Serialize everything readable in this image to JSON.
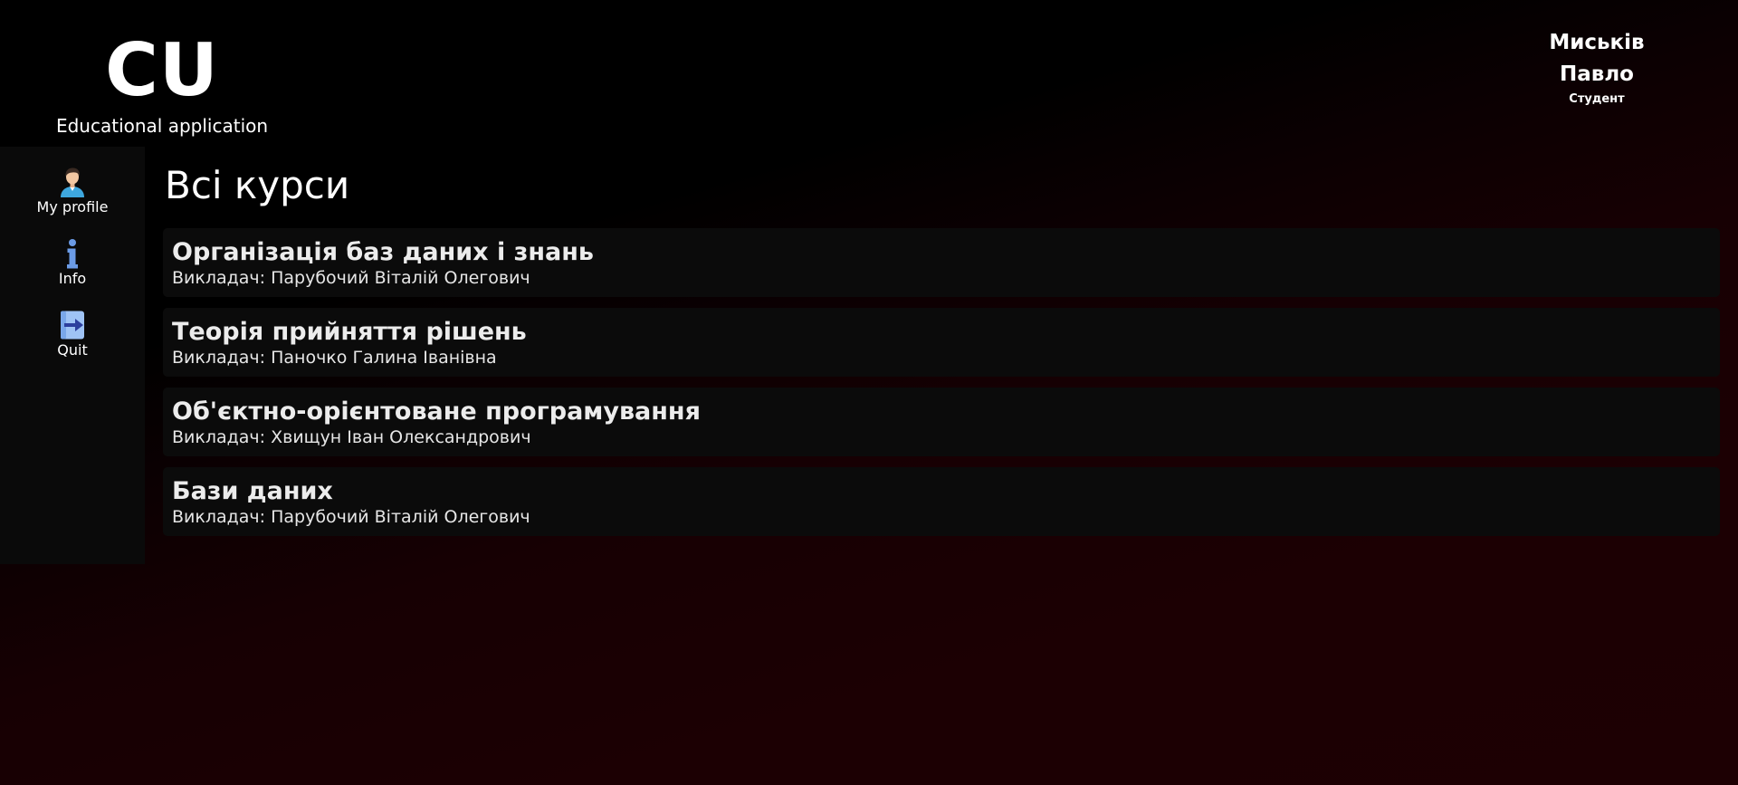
{
  "header": {
    "logo": "CU",
    "subtitle": "Educational application"
  },
  "user": {
    "first_line": "Миськів",
    "second_line": "Павло",
    "role": "Студент"
  },
  "sidebar": {
    "items": [
      {
        "label": "My profile",
        "icon": "user-avatar-icon"
      },
      {
        "label": "Info",
        "icon": "info-icon"
      },
      {
        "label": "Quit",
        "icon": "exit-arrow-icon"
      }
    ]
  },
  "main": {
    "title": "Всі курси",
    "courses": [
      {
        "title": "Організація баз даних і знань",
        "teacher_prefix": "Викладач:",
        "teacher": "Парубочий Віталій Олегович"
      },
      {
        "title": "Теорія прийняття рішень",
        "teacher_prefix": "Викладач:",
        "teacher": "Паночко Галина Іванівна"
      },
      {
        "title": "Об'єктно-орієнтоване програмування",
        "teacher_prefix": "Викладач:",
        "teacher": "Хвищун Іван Олександрович"
      },
      {
        "title": "Бази даних",
        "teacher_prefix": "Викладач:",
        "teacher": "Парубочий Віталій Олегович"
      }
    ]
  },
  "colors": {
    "background_top": "#000000",
    "background_bottom": "#1d0003",
    "sidebar": "#0a0a0a",
    "card": "#0b0b0b",
    "text": "#ffffff",
    "icon_blue": "#5b8fe0"
  }
}
